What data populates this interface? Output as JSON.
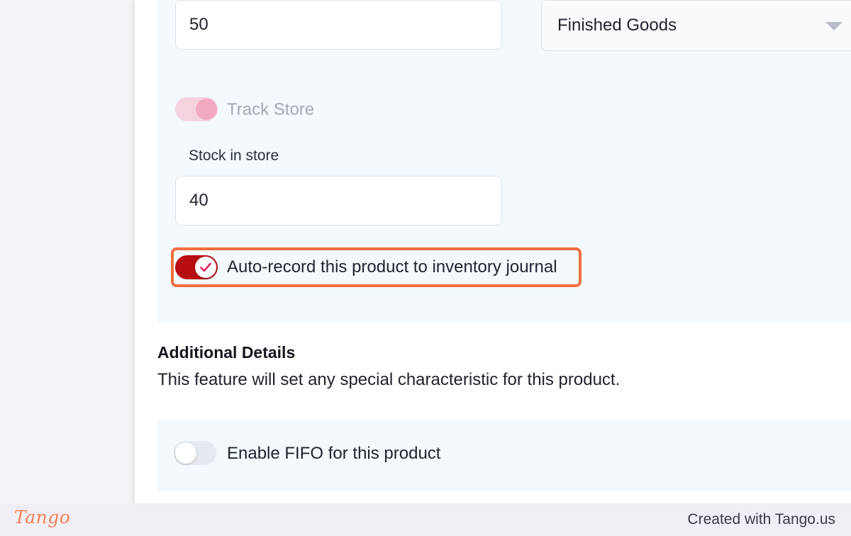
{
  "form": {
    "quantity_value": "50",
    "category_select": {
      "selected": "Finished Goods"
    },
    "track_store": {
      "label": "Track Store",
      "state": "on-disabled"
    },
    "stock_in_store": {
      "label": "Stock in store",
      "value": "40"
    },
    "auto_record": {
      "label": "Auto-record this product to inventory journal",
      "state": "on"
    }
  },
  "additional_details": {
    "title": "Additional Details",
    "description": "This feature will set any special characteristic for this product.",
    "fifo": {
      "label": "Enable FIFO for this product",
      "state": "off"
    }
  },
  "footer": {
    "logo_text": "Tango",
    "credit": "Created with Tango.us"
  },
  "colors": {
    "accent_toggle": "#b80d12",
    "highlight_border": "#f26d3d",
    "section_background": "#f3f9fd",
    "check_color": "#e0245e"
  }
}
